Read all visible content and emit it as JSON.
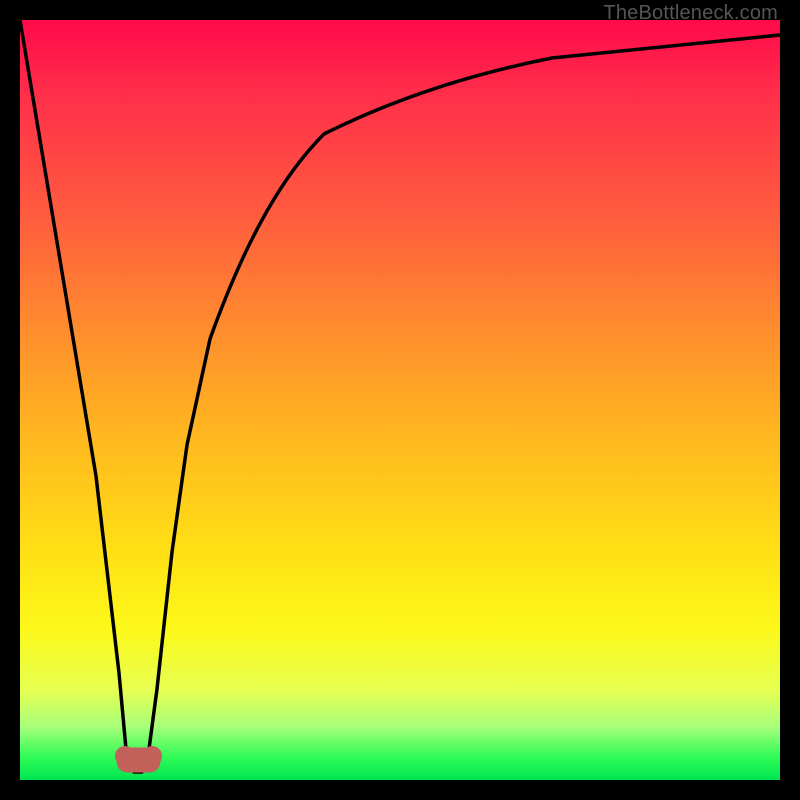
{
  "watermark": "TheBottleneck.com",
  "chart_data": {
    "type": "line",
    "title": "",
    "xlabel": "",
    "ylabel": "",
    "xlim": [
      0,
      100
    ],
    "ylim": [
      0,
      100
    ],
    "grid": false,
    "legend": false,
    "background_gradient": {
      "stops": [
        {
          "pos": 0.0,
          "color": "#ff0a4a"
        },
        {
          "pos": 0.25,
          "color": "#ff5a3f"
        },
        {
          "pos": 0.55,
          "color": "#ffb81f"
        },
        {
          "pos": 0.8,
          "color": "#fdf81a"
        },
        {
          "pos": 0.97,
          "color": "#2ffb57"
        },
        {
          "pos": 1.0,
          "color": "#00e552"
        }
      ]
    },
    "series": [
      {
        "name": "bottleneck-curve",
        "color": "#000000",
        "x": [
          0,
          5,
          10,
          13,
          14,
          15,
          16,
          17,
          18,
          20,
          22,
          25,
          30,
          35,
          40,
          50,
          60,
          70,
          80,
          90,
          100
        ],
        "y": [
          100,
          70,
          40,
          14,
          4,
          1,
          1,
          4,
          12,
          30,
          44,
          58,
          72,
          80,
          85,
          90,
          93,
          95,
          96,
          97,
          98
        ]
      }
    ],
    "marker": {
      "name": "min-point-blob",
      "color": "#c2605a",
      "x": 15,
      "y": 1,
      "shape": "rounded-blob"
    }
  }
}
